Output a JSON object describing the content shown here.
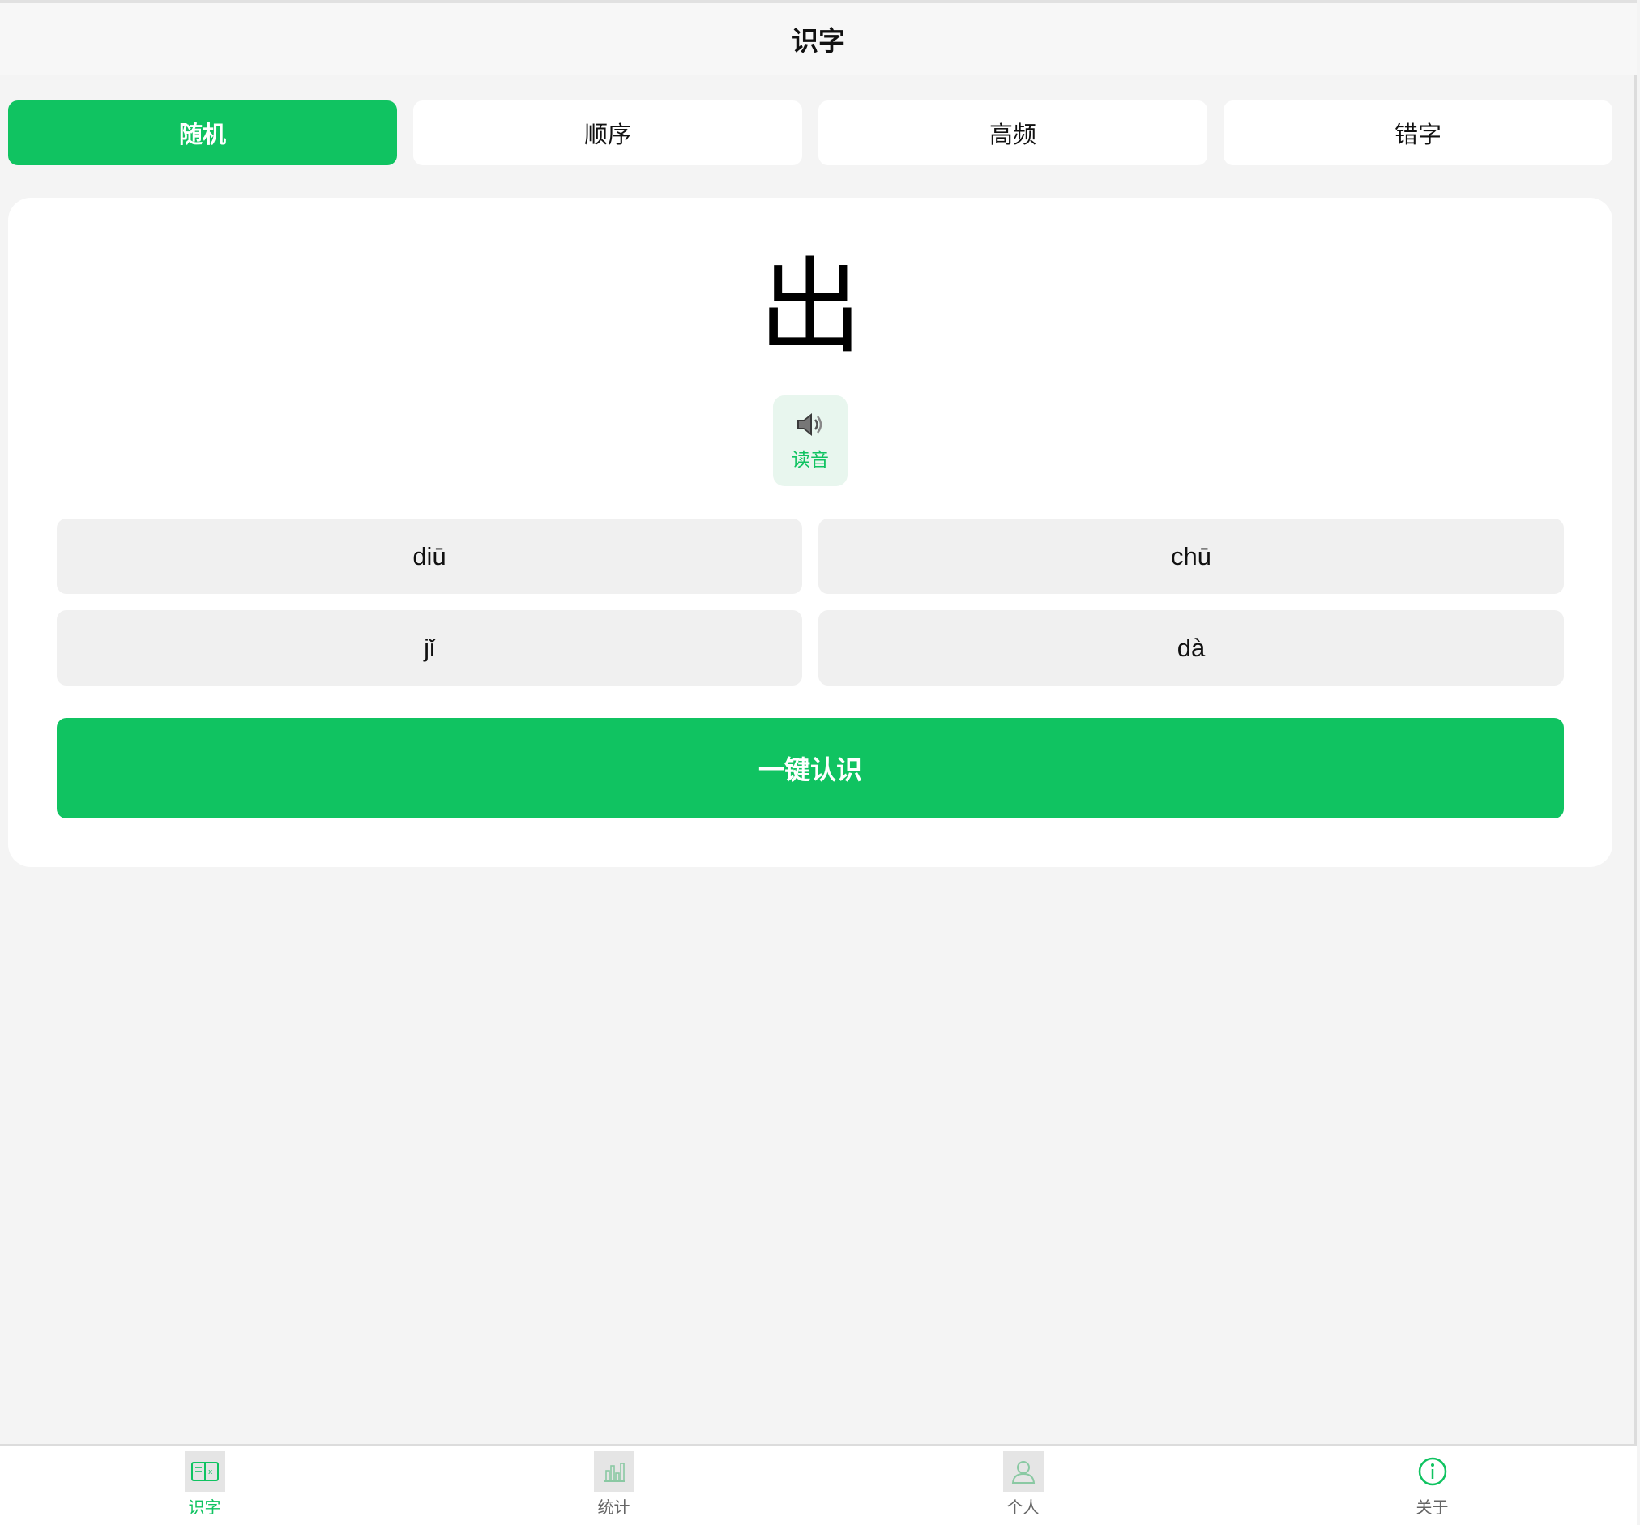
{
  "header": {
    "title": "识字"
  },
  "tabs": [
    {
      "label": "随机",
      "active": true
    },
    {
      "label": "顺序",
      "active": false
    },
    {
      "label": "高频",
      "active": false
    },
    {
      "label": "错字",
      "active": false
    }
  ],
  "card": {
    "character": "出",
    "read_button": {
      "icon": "speaker-icon",
      "label": "读音"
    },
    "options": [
      "diū",
      "chū",
      "jǐ",
      "dà"
    ],
    "know_button": "一键认识"
  },
  "bottom_nav": [
    {
      "label": "识字",
      "icon": "book-icon",
      "active": true
    },
    {
      "label": "统计",
      "icon": "bar-chart-icon",
      "active": false
    },
    {
      "label": "个人",
      "icon": "person-icon",
      "active": false
    },
    {
      "label": "关于",
      "icon": "info-icon",
      "active": false
    }
  ],
  "colors": {
    "accent": "#10c361",
    "background": "#f4f4f4",
    "option_bg": "#f0f0f0"
  }
}
